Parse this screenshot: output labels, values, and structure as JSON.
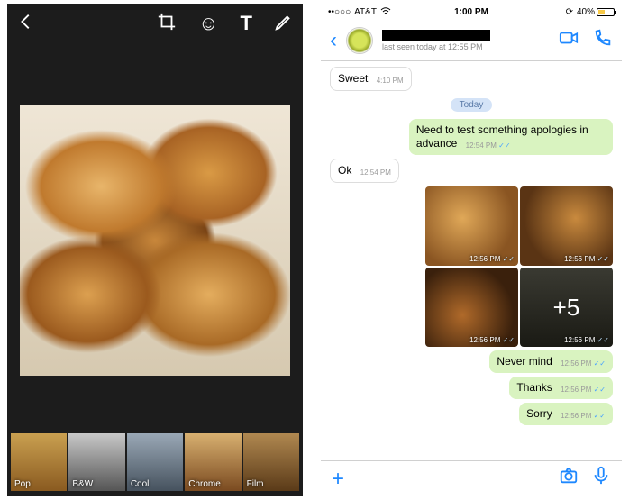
{
  "editor": {
    "filters": [
      "Pop",
      "B&W",
      "Cool",
      "Chrome",
      "Film"
    ]
  },
  "status": {
    "carrier": "AT&T",
    "signal_dots": "••○○○",
    "wifi_icon": "wifi",
    "time": "1:00 PM",
    "battery_pct": "40%"
  },
  "chat_header": {
    "last_seen": "last seen today at 12:55 PM"
  },
  "date_separator": "Today",
  "messages": [
    {
      "dir": "in",
      "text": "Sweet",
      "time": "4:10 PM"
    },
    {
      "dir": "out",
      "text": "Need to test something apologies in advance",
      "time": "12:54 PM",
      "ticks": true
    },
    {
      "dir": "in",
      "text": "Ok",
      "time": "12:54 PM"
    }
  ],
  "media_grid": {
    "tile_time": "12:56 PM",
    "overflow_label": "+5",
    "ticks": true
  },
  "tail_messages": [
    {
      "dir": "out",
      "text": "Never mind",
      "time": "12:56 PM",
      "ticks": true
    },
    {
      "dir": "out",
      "text": "Thanks",
      "time": "12:56 PM",
      "ticks": true
    },
    {
      "dir": "out",
      "text": "Sorry",
      "time": "12:56 PM",
      "ticks": true
    }
  ]
}
